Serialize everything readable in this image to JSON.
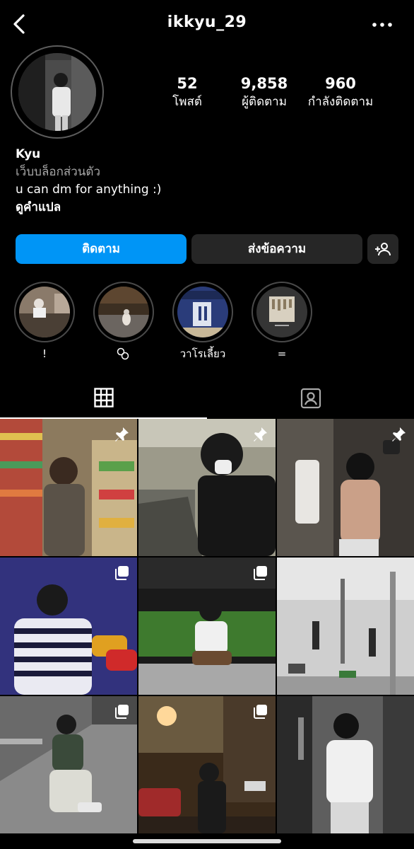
{
  "header": {
    "username": "ikkyu_29",
    "back_icon": "chevron-left-icon",
    "more_icon": "ellipsis-icon"
  },
  "profile": {
    "avatar": "profile-photo"
  },
  "stats": [
    {
      "value": "52",
      "label": "โพสต์"
    },
    {
      "value": "9,858",
      "label": "ผู้ติดตาม"
    },
    {
      "value": "960",
      "label": "กำลังติดตาม"
    }
  ],
  "bio": {
    "name": "Kyu",
    "category": "เว็บบล็อกส่วนตัว",
    "text": "u can dm for anything :)",
    "translate": "ดูคำแปล"
  },
  "actions": {
    "follow": "ติดตาม",
    "message": "ส่งข้อความ",
    "add_person_icon": "add-person-icon"
  },
  "highlights": [
    {
      "label": "!"
    },
    {
      "label": "⚬⚬"
    },
    {
      "label": "วาโรเลี้ยว"
    },
    {
      "label": "="
    }
  ],
  "tabs": [
    {
      "name": "posts-grid",
      "icon": "grid-icon",
      "active": true
    },
    {
      "name": "tagged",
      "icon": "tagged-person-icon",
      "active": false
    }
  ],
  "posts": [
    {
      "badge": "pin"
    },
    {
      "badge": "pin"
    },
    {
      "badge": "pin"
    },
    {
      "badge": "multi"
    },
    {
      "badge": "multi"
    },
    {
      "badge": ""
    },
    {
      "badge": "multi"
    },
    {
      "badge": "multi"
    },
    {
      "badge": ""
    }
  ],
  "colors": {
    "accent": "#0095f6",
    "button_dark": "#262626",
    "background": "#000000"
  }
}
